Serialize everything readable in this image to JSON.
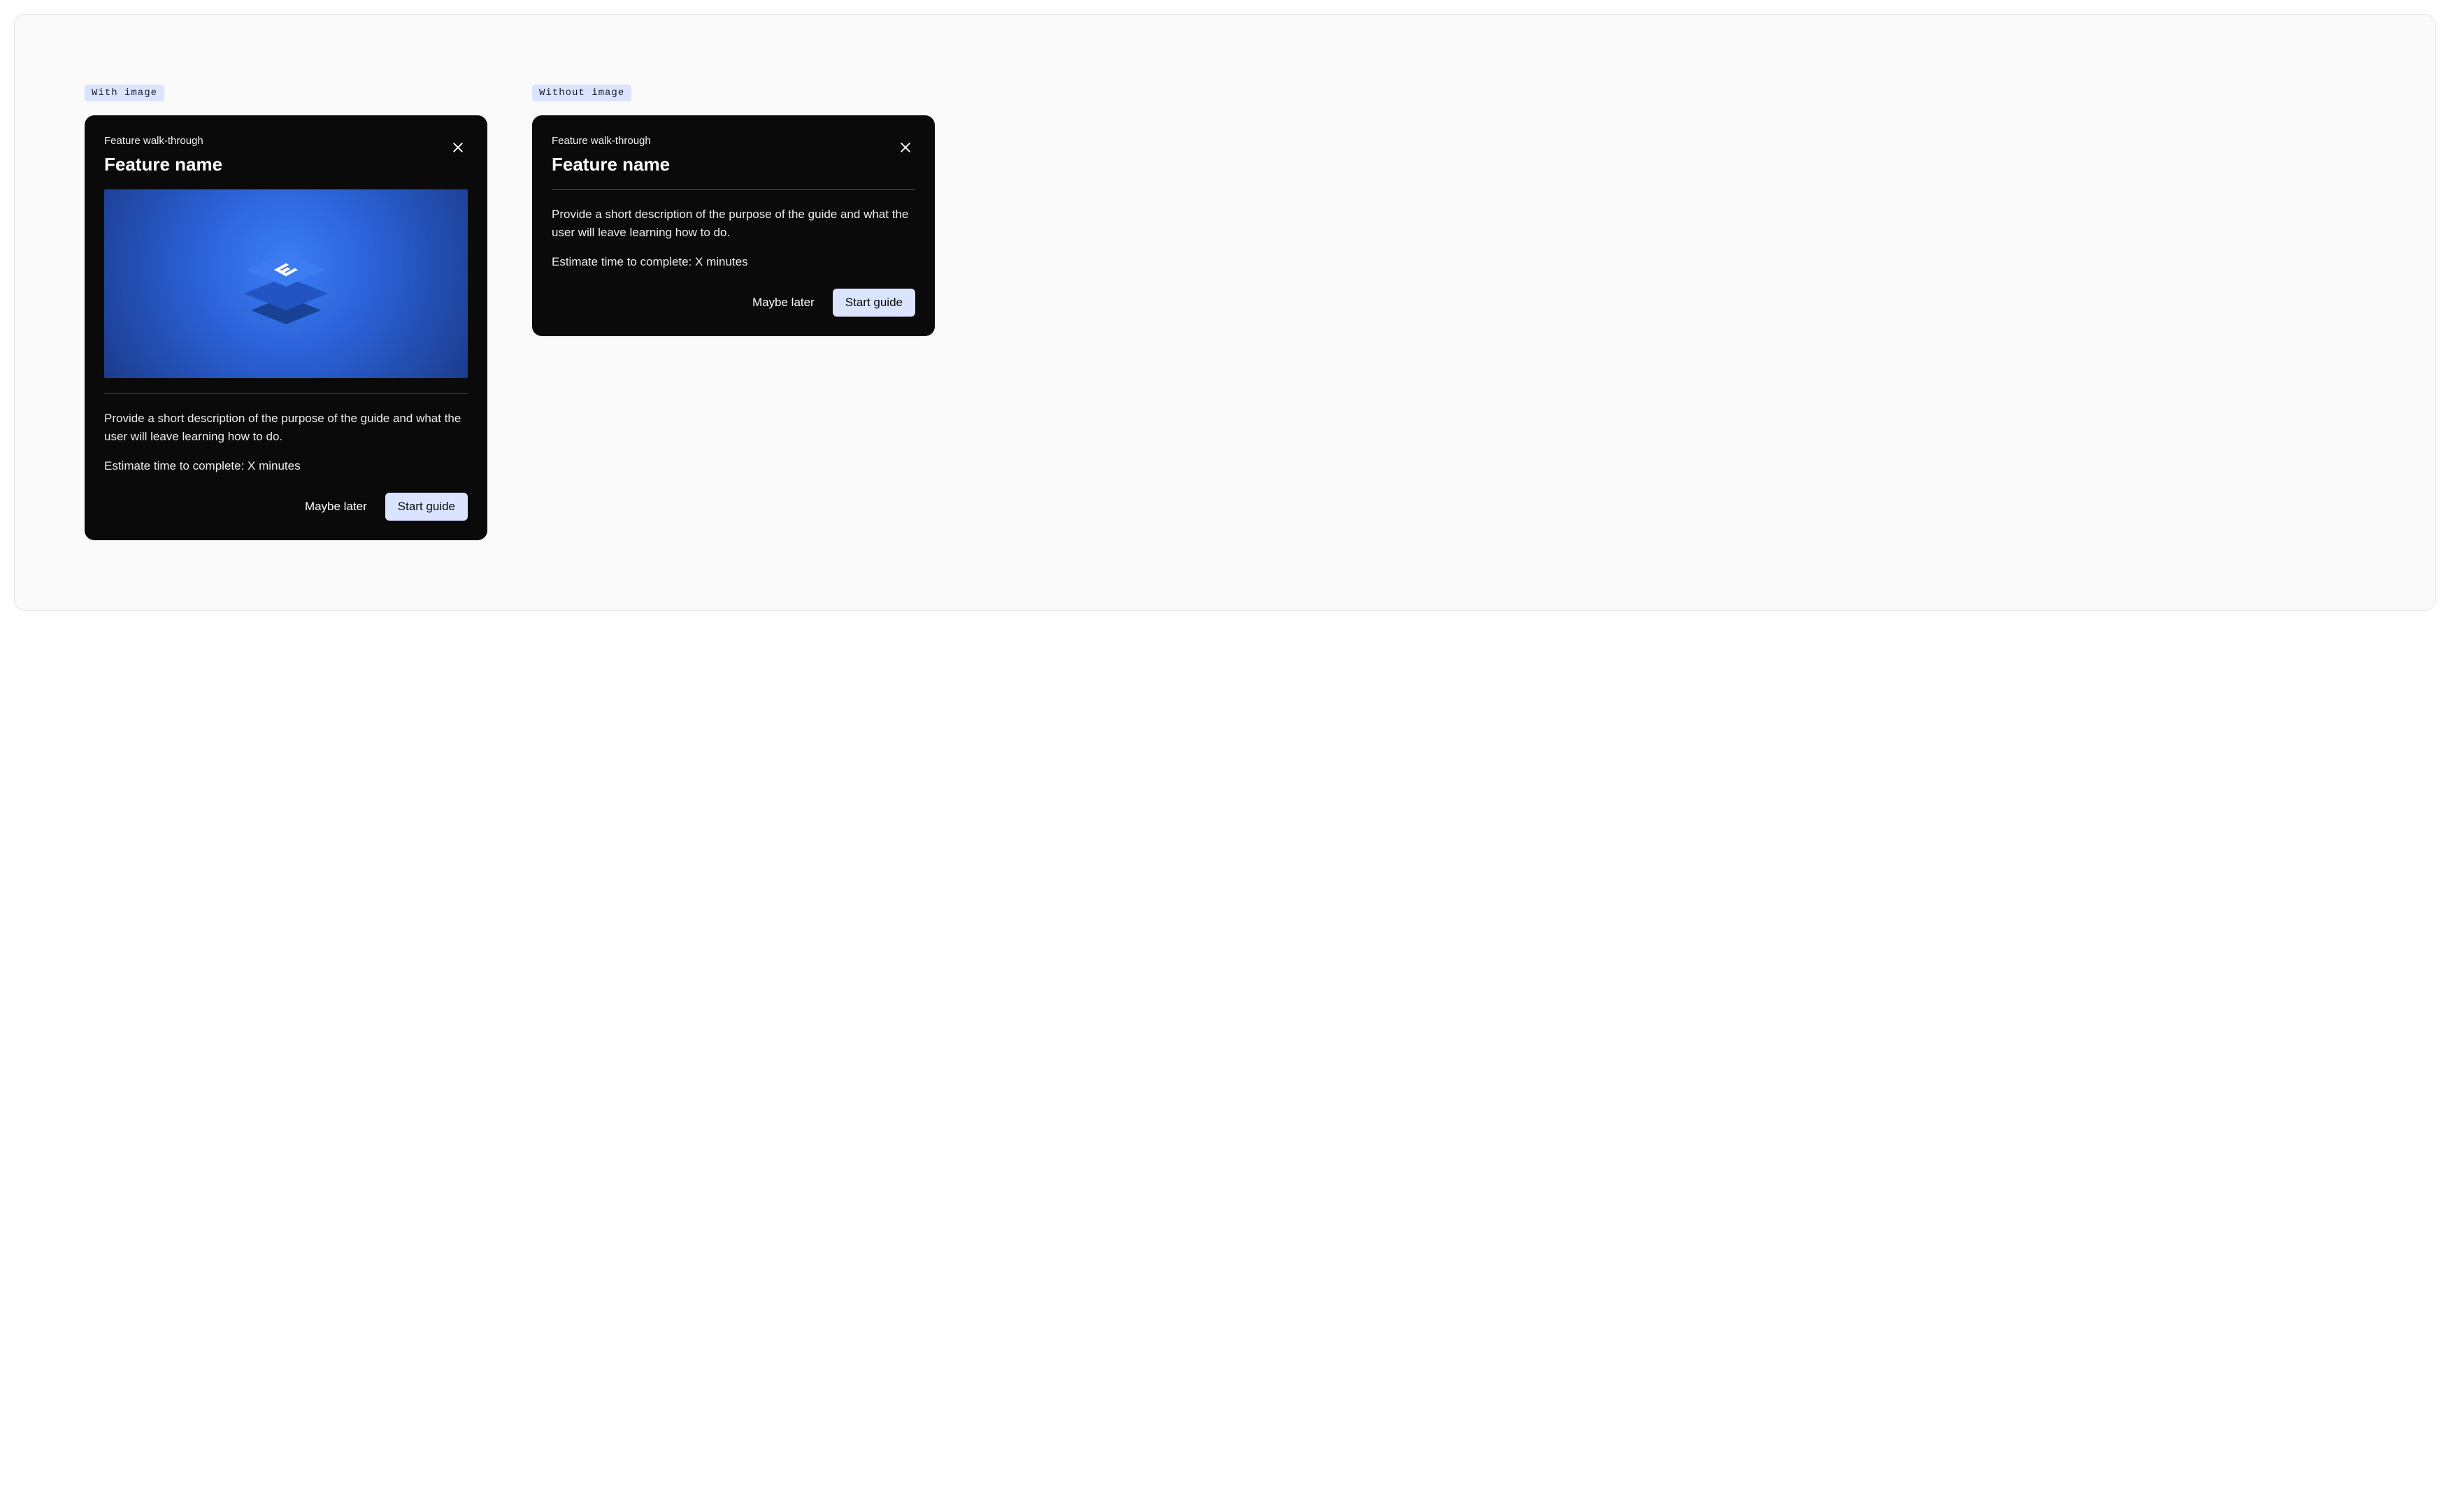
{
  "variants": {
    "with_image": {
      "label": "With image",
      "eyebrow": "Feature walk-through",
      "title": "Feature name",
      "description": "Provide a short description of the purpose of the guide and what the user will leave learning how to do.",
      "estimate": "Estimate time to complete: X minutes",
      "secondary_btn": "Maybe later",
      "primary_btn": "Start guide"
    },
    "without_image": {
      "label": "Without image",
      "eyebrow": "Feature walk-through",
      "title": "Feature name",
      "description": "Provide a short description of the purpose of the guide and what the user will leave learning how to do.",
      "estimate": "Estimate time to complete: X minutes",
      "secondary_btn": "Maybe later",
      "primary_btn": "Start guide"
    }
  }
}
